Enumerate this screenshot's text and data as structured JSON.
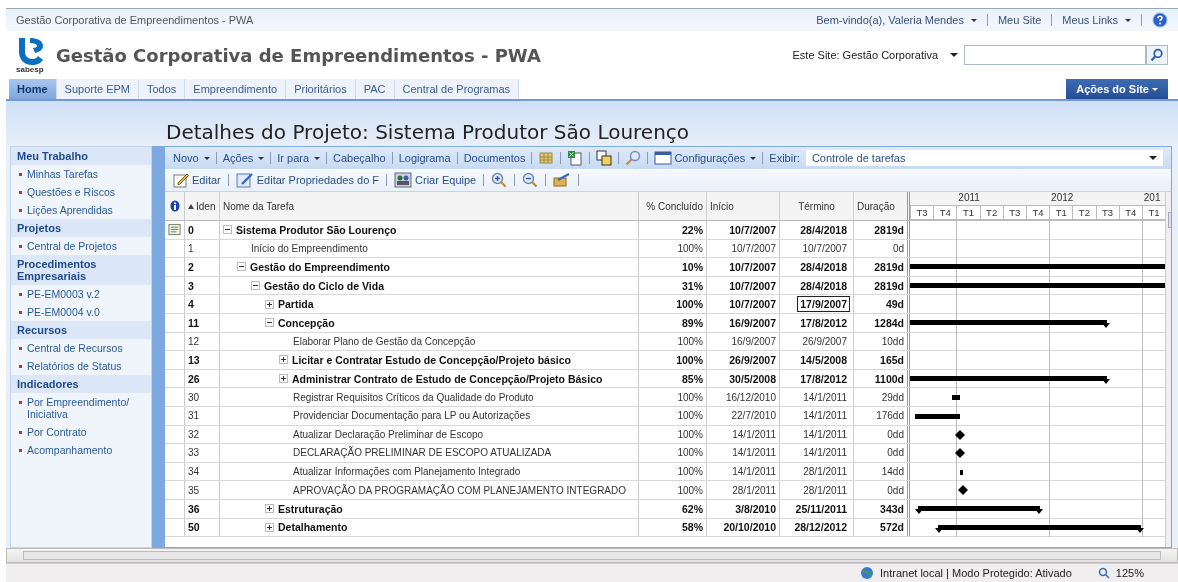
{
  "browser_title": "Gestão Corporativa de Empreendimentos - PWA",
  "user_links": [
    {
      "label": "Bem-vindo(a), Valeria Mendes",
      "menu": true
    },
    {
      "label": "Meu Site",
      "menu": false
    },
    {
      "label": "Meus Links",
      "menu": true
    }
  ],
  "logo_text": "sabesp",
  "site_title": "Gestão Corporativa de Empreendimentos - PWA",
  "search": {
    "scope": "Este Site: Gestão Corporativa"
  },
  "nav_tabs": [
    {
      "label": "Home",
      "selected": true
    },
    {
      "label": "Suporte EPM",
      "selected": false
    },
    {
      "label": "Todos",
      "selected": false
    },
    {
      "label": "Empreendimento",
      "selected": false
    },
    {
      "label": "Prioritários",
      "selected": false
    },
    {
      "label": "PAC",
      "selected": false
    },
    {
      "label": "Central de Programas",
      "selected": false
    }
  ],
  "site_actions": "Ações do Site",
  "page_title": "Detalhes do Projeto: Sistema Produtor São Lourenço",
  "sidebar": [
    {
      "title": "Meu Trabalho",
      "items": [
        "Minhas Tarefas",
        "Questões e Riscos",
        "Lições Aprendidas"
      ]
    },
    {
      "title": "Projetos",
      "items": [
        "Central de Projetos"
      ]
    },
    {
      "title": "Procedimentos Empresariais",
      "items": [
        "PE-EM0003 v.2",
        "PE-EM0004 v.0"
      ]
    },
    {
      "title": "Recursos",
      "items": [
        "Central de Recursos",
        "Relatórios de Status"
      ]
    },
    {
      "title": "Indicadores",
      "items": [
        "Por Empreendimento/ Iniciativa",
        "Por Contrato",
        "Acompanhamento"
      ]
    }
  ],
  "toolbar": {
    "menus": [
      {
        "label": "Novo",
        "kind": "menu"
      },
      {
        "label": "Ações",
        "kind": "menu"
      },
      {
        "label": "Ir para",
        "kind": "menu"
      },
      {
        "label": "Cabeçalho",
        "kind": "link"
      },
      {
        "label": "Logigrama",
        "kind": "link"
      },
      {
        "label": "Documentos",
        "kind": "link"
      }
    ],
    "settings": "Configurações",
    "view_label": "Exibir:",
    "view_value": "Controle de tarefas"
  },
  "actions": [
    "Editar",
    "Editar Propriedades do F",
    "Criar Equipe"
  ],
  "columns": [
    "Iden",
    "Nome da Tarefa",
    "% Concluído",
    "Início",
    "Término",
    "Duração"
  ],
  "gantt": {
    "leading_quarters": [
      "T3",
      "T4"
    ],
    "years": [
      {
        "label": "2011",
        "quarters": [
          "T1",
          "T2",
          "T3",
          "T4"
        ]
      },
      {
        "label": "2012",
        "quarters": [
          "T1",
          "T2",
          "T3",
          "T4"
        ]
      },
      {
        "label": "201",
        "quarters": [
          "T1"
        ]
      }
    ]
  },
  "tasks": [
    {
      "id": "0",
      "name": "Sistema Produtor São Lourenço",
      "kind": "project",
      "expanded": true,
      "note": true,
      "end_focused": false,
      "complete": "22%",
      "start": "10/7/2007",
      "end": "28/4/2018",
      "duration": "2819d",
      "children": [
        {
          "id": "1",
          "name": "Início do Empreendimento",
          "kind": "task",
          "note": false,
          "end_focused": false,
          "complete": "100%",
          "start": "10/7/2007",
          "end": "10/7/2007",
          "duration": "0d"
        },
        {
          "id": "2",
          "name": "Gestão do Empreendimento",
          "kind": "summary",
          "expanded": true,
          "note": false,
          "end_focused": false,
          "complete": "10%",
          "start": "10/7/2007",
          "end": "28/4/2018",
          "duration": "2819d",
          "children": [
            {
              "id": "3",
              "name": "Gestão do Ciclo de Vida",
              "kind": "summary",
              "expanded": true,
              "note": false,
              "end_focused": false,
              "complete": "31%",
              "start": "10/7/2007",
              "end": "28/4/2018",
              "duration": "2819d",
              "children": [
                {
                  "id": "4",
                  "name": "Partida",
                  "kind": "summary",
                  "expanded": false,
                  "note": false,
                  "end_focused": true,
                  "complete": "100%",
                  "start": "10/7/2007",
                  "end": "17/9/2007",
                  "duration": "49d"
                },
                {
                  "id": "11",
                  "name": "Concepção",
                  "kind": "summary",
                  "expanded": true,
                  "note": false,
                  "end_focused": false,
                  "complete": "89%",
                  "start": "16/9/2007",
                  "end": "17/8/2012",
                  "duration": "1284d",
                  "children": [
                    {
                      "id": "12",
                      "name": "Elaborar Plano de Gestão da Concepção",
                      "kind": "task",
                      "note": false,
                      "end_focused": false,
                      "complete": "100%",
                      "start": "16/9/2007",
                      "end": "26/9/2007",
                      "duration": "10dd"
                    },
                    {
                      "id": "13",
                      "name": "Licitar e Contratar Estudo de Concepção/Projeto básico",
                      "kind": "summary",
                      "expanded": false,
                      "note": false,
                      "end_focused": false,
                      "complete": "100%",
                      "start": "26/9/2007",
                      "end": "14/5/2008",
                      "duration": "165d"
                    },
                    {
                      "id": "26",
                      "name": "Administrar Contrato de Estudo de Concepção/Projeto Básico",
                      "kind": "summary",
                      "expanded": false,
                      "note": false,
                      "end_focused": false,
                      "complete": "85%",
                      "start": "30/5/2008",
                      "end": "17/8/2012",
                      "duration": "1100d"
                    },
                    {
                      "id": "30",
                      "name": "Registrar Requisitos Críticos da Qualidade do Produto",
                      "kind": "task",
                      "note": false,
                      "end_focused": false,
                      "complete": "100%",
                      "start": "16/12/2010",
                      "end": "14/1/2011",
                      "duration": "29dd"
                    },
                    {
                      "id": "31",
                      "name": "Providenciar Documentação para LP ou Autorizações",
                      "kind": "task",
                      "note": false,
                      "end_focused": false,
                      "complete": "100%",
                      "start": "22/7/2010",
                      "end": "14/1/2011",
                      "duration": "176dd"
                    },
                    {
                      "id": "32",
                      "name": "Atualizar Declaração Preliminar de Escopo",
                      "kind": "milestone",
                      "note": false,
                      "end_focused": false,
                      "complete": "100%",
                      "start": "14/1/2011",
                      "end": "14/1/2011",
                      "duration": "0dd"
                    },
                    {
                      "id": "33",
                      "name": "DECLARAÇÃO PRELIMINAR DE ESCOPO ATUALIZADA",
                      "kind": "milestone",
                      "note": false,
                      "end_focused": false,
                      "complete": "100%",
                      "start": "14/1/2011",
                      "end": "14/1/2011",
                      "duration": "0dd"
                    },
                    {
                      "id": "34",
                      "name": "Atualizar Informações com Planejamento Integrado",
                      "kind": "task",
                      "note": false,
                      "end_focused": false,
                      "complete": "100%",
                      "start": "14/1/2011",
                      "end": "28/1/2011",
                      "duration": "14dd"
                    },
                    {
                      "id": "35",
                      "name": "APROVAÇÃO DA PROGRAMAÇÃO COM PLANEJAMENTO INTEGRADO",
                      "kind": "milestone",
                      "note": false,
                      "end_focused": false,
                      "complete": "100%",
                      "start": "28/1/2011",
                      "end": "28/1/2011",
                      "duration": "0dd"
                    }
                  ]
                },
                {
                  "id": "36",
                  "name": "Estruturação",
                  "kind": "summary",
                  "expanded": false,
                  "note": false,
                  "end_focused": false,
                  "complete": "62%",
                  "start": "3/8/2010",
                  "end": "25/11/2011",
                  "duration": "343d"
                },
                {
                  "id": "50",
                  "name": "Detalhamento",
                  "kind": "summary",
                  "expanded": false,
                  "note": false,
                  "end_focused": false,
                  "complete": "58%",
                  "start": "20/10/2010",
                  "end": "28/12/2012",
                  "duration": "572d"
                }
              ]
            }
          ]
        }
      ]
    }
  ],
  "status": {
    "zone": "Intranet local | Modo Protegido: Ativado",
    "zoom": "125%"
  }
}
